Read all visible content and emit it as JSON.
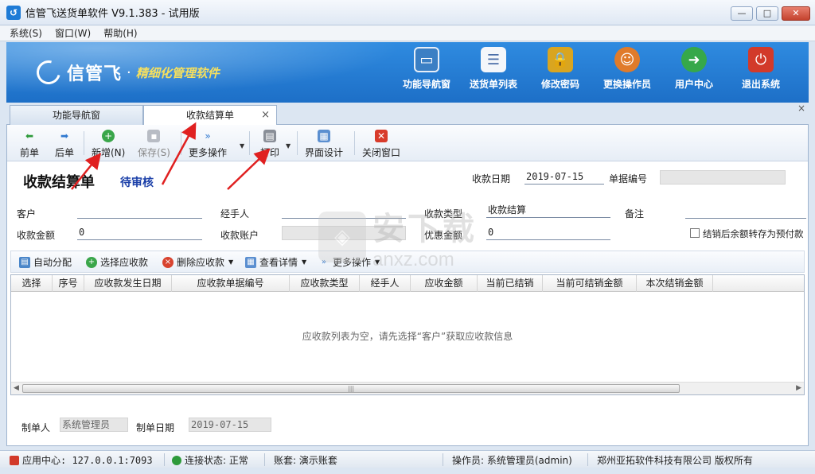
{
  "window": {
    "title": "信管飞送货单软件 V9.1.383 - 试用版",
    "min": "—",
    "max": "□",
    "close": "✕"
  },
  "menu": [
    "系统(S)",
    "窗口(W)",
    "帮助(H)"
  ],
  "banner": {
    "brand": "信管飞",
    "dot": "·",
    "slogan": "精细化管理软件",
    "nav": [
      {
        "label": "功能导航窗",
        "icon": "monitor-icon",
        "color": "#3b7fc4"
      },
      {
        "label": "送货单列表",
        "icon": "list-icon",
        "color": "#4b6ea8"
      },
      {
        "label": "修改密码",
        "icon": "lock-icon",
        "color": "#d9a520"
      },
      {
        "label": "更换操作员",
        "icon": "user-icon",
        "color": "#e07b2a"
      },
      {
        "label": "用户中心",
        "icon": "globe-icon",
        "color": "#36a84a"
      },
      {
        "label": "退出系统",
        "icon": "power-icon",
        "color": "#d23a2a"
      }
    ]
  },
  "tabs": {
    "nav_tab": "功能导航窗",
    "active_tab": "收款结算单",
    "tab_close": "×",
    "strip_close": "×"
  },
  "toolbar": {
    "prev": "前单",
    "next": "后单",
    "new": "新增(N)",
    "save": "保存(S)",
    "more": "更多操作",
    "print": "打印",
    "layout": "界面设计",
    "close_window": "关闭窗口"
  },
  "form": {
    "title": "收款结算单",
    "status": "待审核",
    "date_label": "收款日期",
    "date_value": "2019-07-15",
    "doc_no_label": "单据编号",
    "doc_no_value": "",
    "customer_label": "客户",
    "customer_value": "",
    "handler_label": "经手人",
    "handler_value": "",
    "type_label": "收款类型",
    "type_value": "收款结算",
    "remark_label": "备注",
    "remark_value": "",
    "amount_label": "收款金额",
    "amount_value": "0",
    "account_label": "收款账户",
    "account_value": "",
    "discount_label": "优惠金额",
    "discount_value": "0",
    "prepay_label": "结销后余额转存为预付款"
  },
  "subtoolbar": {
    "auto_assign": "自动分配",
    "select_receivable": "选择应收款",
    "delete_receivable": "删除应收款",
    "view_detail": "查看详情",
    "more": "更多操作"
  },
  "grid": {
    "columns": [
      "选择",
      "序号",
      "应收款发生日期",
      "应收款单据编号",
      "应收款类型",
      "经手人",
      "应收金额",
      "当前已结销",
      "当前可结销金额",
      "本次结销金额"
    ],
    "empty_message": "应收款列表为空，请先选择“客户”获取应收款信息"
  },
  "footer": {
    "creator_label": "制单人",
    "creator_value": "系统管理员",
    "create_date_label": "制单日期",
    "create_date_value": "2019-07-15"
  },
  "statusbar": {
    "app_center": "应用中心: 127.0.0.1:7093",
    "connection": "连接状态: 正常",
    "account_set": "账套: 演示账套",
    "operator": "操作员: 系统管理员(admin)",
    "copyright": "郑州亚拓软件科技有限公司 版权所有"
  },
  "watermark": {
    "big": "安下载",
    "small": "anxz.com"
  }
}
